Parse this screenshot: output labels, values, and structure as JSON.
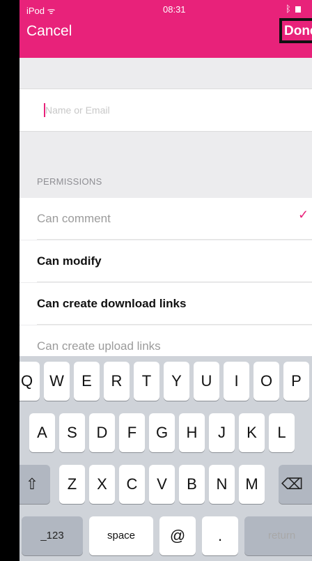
{
  "status_bar": {
    "carrier": "iPod ᯤ",
    "time": "08:31",
    "bluetooth": "ᛒ"
  },
  "nav": {
    "cancel_label": "Cancel",
    "done_label": "Done"
  },
  "recipient_input": {
    "placeholder": "Name or Email",
    "value": ""
  },
  "permissions": {
    "header": "PERMISSIONS",
    "items": [
      {
        "label": "Can comment",
        "checked": true,
        "style": "dim"
      },
      {
        "label": "Can modify",
        "checked": false,
        "style": "bold"
      },
      {
        "label": "Can create download links",
        "checked": false,
        "style": "bold"
      },
      {
        "label": "Can create upload links",
        "checked": false,
        "style": "dim"
      }
    ],
    "check_glyph": "✓"
  },
  "keyboard": {
    "row1": [
      "Q",
      "W",
      "E",
      "R",
      "T",
      "Y",
      "U",
      "I",
      "O",
      "P"
    ],
    "row2": [
      "A",
      "S",
      "D",
      "F",
      "G",
      "H",
      "J",
      "K",
      "L"
    ],
    "row3": [
      "Z",
      "X",
      "C",
      "V",
      "B",
      "N",
      "M"
    ],
    "shift_glyph": "⇧",
    "delete_glyph": "⌫",
    "bottom": {
      "numbers": "_123",
      "space": "space",
      "at": "@",
      "dot": ".",
      "return": "return"
    }
  },
  "colors": {
    "accent": "#e8227a",
    "background": "#ececee",
    "keyboard_bg": "#cfd3d9"
  }
}
